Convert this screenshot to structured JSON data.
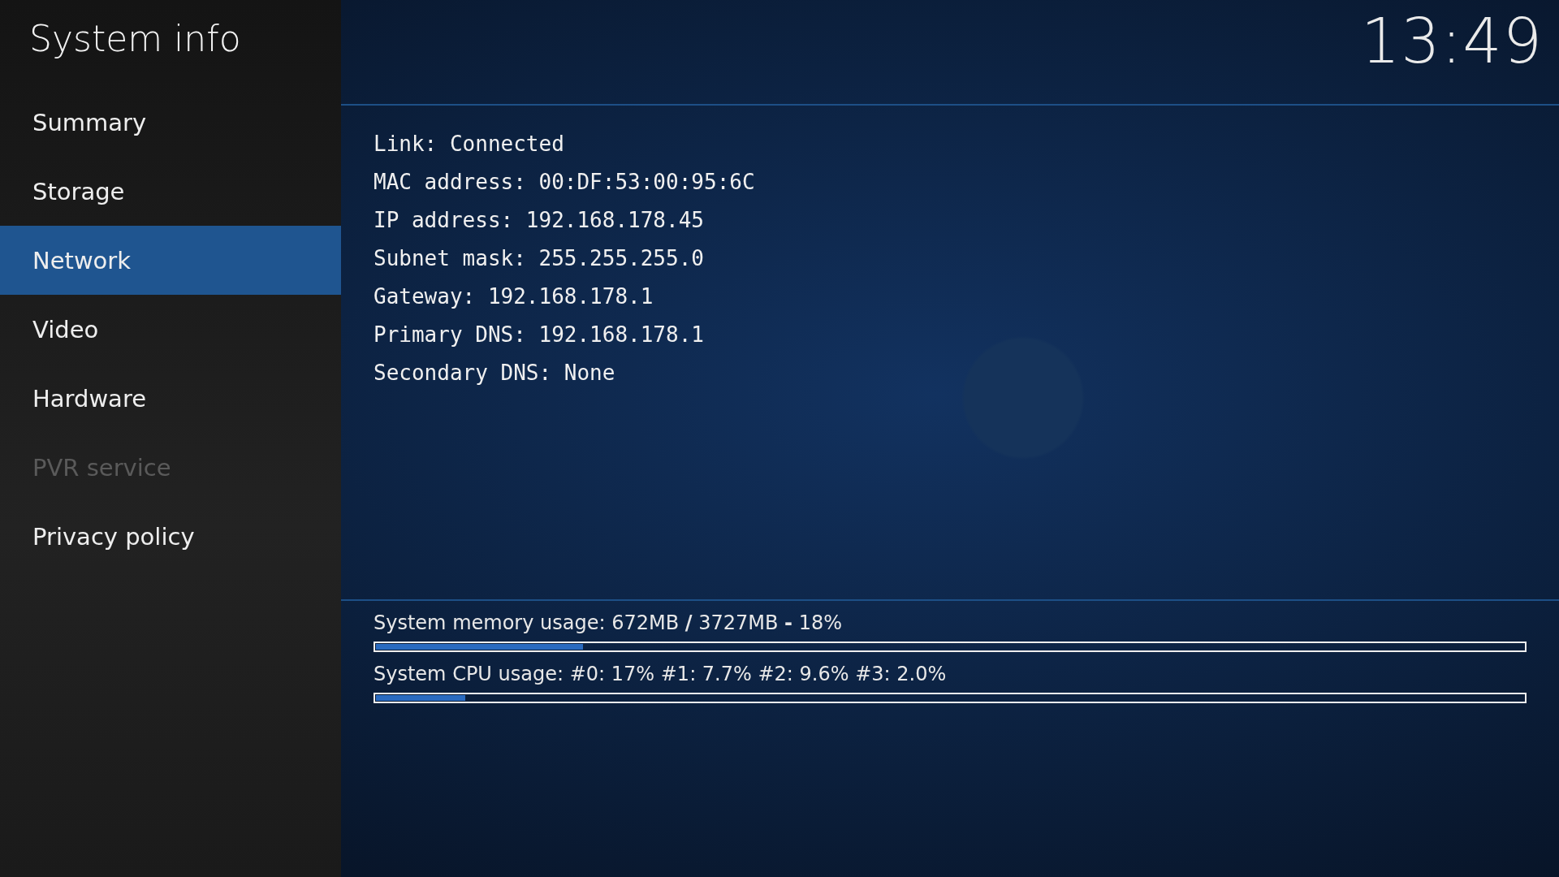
{
  "window": {
    "title": "System info"
  },
  "clock": "13:49",
  "sidebar": {
    "items": [
      {
        "label": "Summary",
        "selected": false,
        "disabled": false
      },
      {
        "label": "Storage",
        "selected": false,
        "disabled": false
      },
      {
        "label": "Network",
        "selected": true,
        "disabled": false
      },
      {
        "label": "Video",
        "selected": false,
        "disabled": false
      },
      {
        "label": "Hardware",
        "selected": false,
        "disabled": false
      },
      {
        "label": "PVR service",
        "selected": false,
        "disabled": true
      },
      {
        "label": "Privacy policy",
        "selected": false,
        "disabled": false
      }
    ]
  },
  "info_lines": [
    "Link: Connected",
    "MAC address: 00:DF:53:00:95:6C",
    "IP address: 192.168.178.45",
    "Subnet mask: 255.255.255.0",
    "Gateway: 192.168.178.1",
    "Primary DNS: 192.168.178.1",
    "Secondary DNS: None"
  ],
  "usage": [
    {
      "label": "System memory usage: 672MB **/** 3727MB **-** 18%",
      "level": 0.18
    },
    {
      "label": "System CPU usage: #0:  17% #1: 7.7% #2: 9.6% #3: 2.0%",
      "level": 0.078
    }
  ]
}
